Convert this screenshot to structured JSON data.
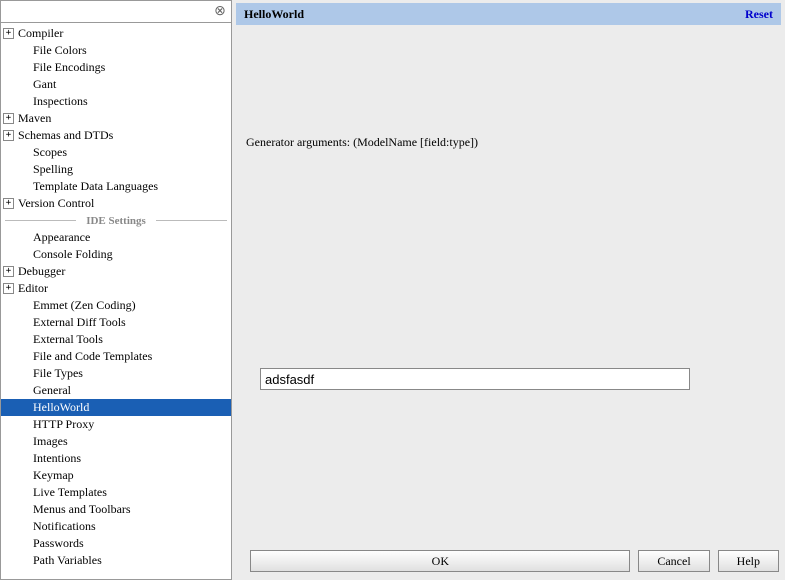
{
  "search": {
    "value": "",
    "placeholder": ""
  },
  "section1_label": "IDE Settings",
  "tree_group1": [
    {
      "label": "Compiler",
      "expandable": true,
      "indent": 0
    },
    {
      "label": "File Colors",
      "expandable": false,
      "indent": 1
    },
    {
      "label": "File Encodings",
      "expandable": false,
      "indent": 1
    },
    {
      "label": "Gant",
      "expandable": false,
      "indent": 1
    },
    {
      "label": "Inspections",
      "expandable": false,
      "indent": 1
    },
    {
      "label": "Maven",
      "expandable": true,
      "indent": 0
    },
    {
      "label": "Schemas and DTDs",
      "expandable": true,
      "indent": 0
    },
    {
      "label": "Scopes",
      "expandable": false,
      "indent": 1
    },
    {
      "label": "Spelling",
      "expandable": false,
      "indent": 1
    },
    {
      "label": "Template Data Languages",
      "expandable": false,
      "indent": 1
    },
    {
      "label": "Version Control",
      "expandable": true,
      "indent": 0
    }
  ],
  "tree_group2": [
    {
      "label": "Appearance",
      "expandable": false,
      "indent": 1
    },
    {
      "label": "Console Folding",
      "expandable": false,
      "indent": 1
    },
    {
      "label": "Debugger",
      "expandable": true,
      "indent": 0
    },
    {
      "label": "Editor",
      "expandable": true,
      "indent": 0
    },
    {
      "label": "Emmet (Zen Coding)",
      "expandable": false,
      "indent": 1
    },
    {
      "label": "External Diff Tools",
      "expandable": false,
      "indent": 1
    },
    {
      "label": "External Tools",
      "expandable": false,
      "indent": 1
    },
    {
      "label": "File and Code Templates",
      "expandable": false,
      "indent": 1
    },
    {
      "label": "File Types",
      "expandable": false,
      "indent": 1
    },
    {
      "label": "General",
      "expandable": false,
      "indent": 1
    },
    {
      "label": "HelloWorld",
      "expandable": false,
      "indent": 1,
      "selected": true
    },
    {
      "label": "HTTP Proxy",
      "expandable": false,
      "indent": 1
    },
    {
      "label": "Images",
      "expandable": false,
      "indent": 1
    },
    {
      "label": "Intentions",
      "expandable": false,
      "indent": 1
    },
    {
      "label": "Keymap",
      "expandable": false,
      "indent": 1
    },
    {
      "label": "Live Templates",
      "expandable": false,
      "indent": 1
    },
    {
      "label": "Menus and Toolbars",
      "expandable": false,
      "indent": 1
    },
    {
      "label": "Notifications",
      "expandable": false,
      "indent": 1
    },
    {
      "label": "Passwords",
      "expandable": false,
      "indent": 1
    },
    {
      "label": "Path Variables",
      "expandable": false,
      "indent": 1
    }
  ],
  "header": {
    "title": "HelloWorld",
    "reset": "Reset"
  },
  "content": {
    "args_label": "Generator arguments: (ModelName [field:type])",
    "input_value": "adsfasdf"
  },
  "buttons": {
    "ok": "OK",
    "cancel": "Cancel",
    "help": "Help"
  }
}
